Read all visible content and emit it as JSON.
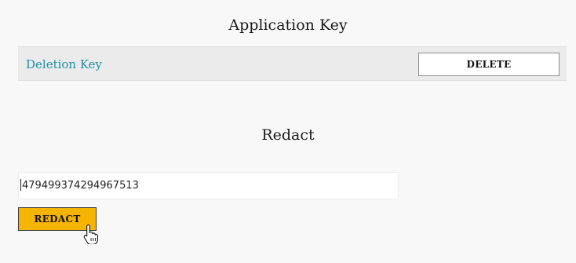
{
  "application_key": {
    "title": "Application Key",
    "deletion_key_label": "Deletion Key",
    "delete_button_label": "DELETE"
  },
  "redact": {
    "title": "Redact",
    "input_value": "479499374294967513",
    "button_label": "REDACT"
  },
  "cursor": {
    "icon": "hand-pointer-icon"
  },
  "colors": {
    "background": "#f8f8f8",
    "row_background": "#ebebeb",
    "link": "#1f8fa8",
    "redact_button": "#f5b400"
  }
}
